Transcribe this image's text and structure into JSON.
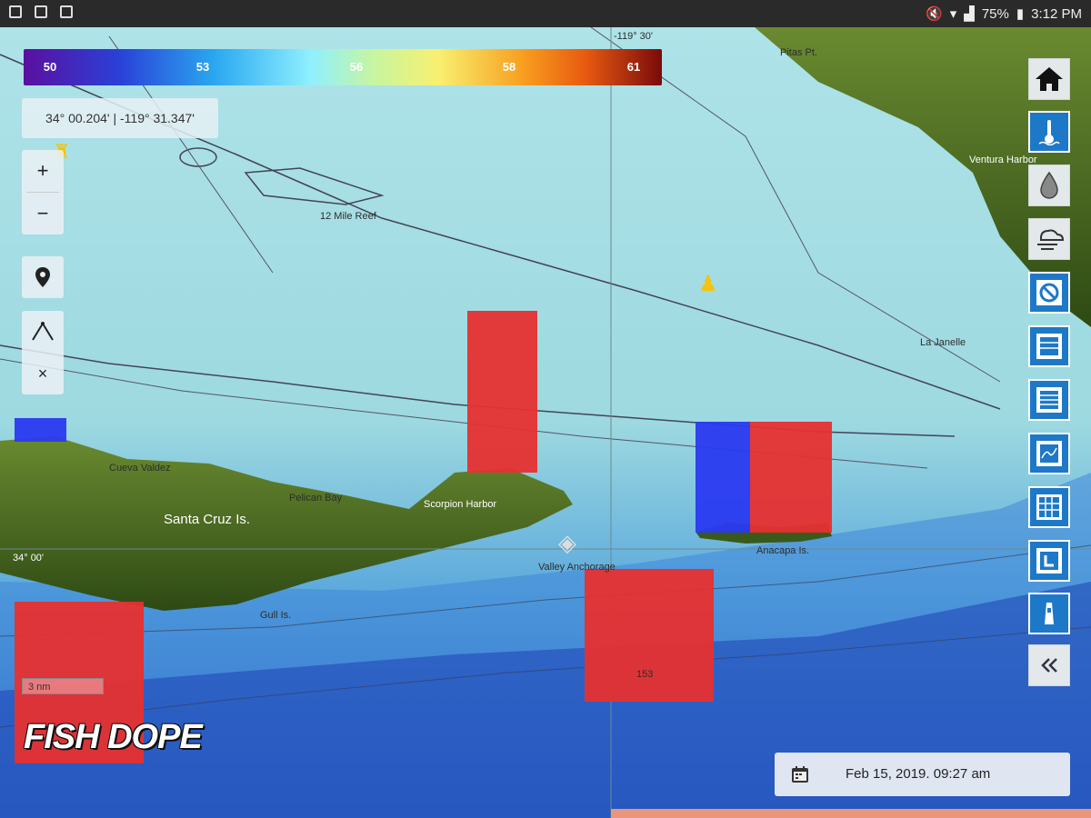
{
  "status": {
    "battery": "75%",
    "time": "3:12 PM"
  },
  "legend": {
    "ticks": [
      "50",
      "53",
      "56",
      "58",
      "61"
    ]
  },
  "coords": "34° 00.204' | -119° 31.347'",
  "map_controls": {
    "zoom_in": "+",
    "zoom_out": "−",
    "close": "×"
  },
  "map_labels": {
    "top_longitude": "-119° 30'",
    "pitas_pt": "Pitas Pt.",
    "ventura_harbor": "Ventura Harbor",
    "reef": "12 Mile Reef",
    "la_janelle": "La Janelle",
    "cueva_valdez": "Cueva Valdez",
    "pelican_bay": "Pelican Bay",
    "santa_cruz": "Santa Cruz Is.",
    "scorpion": "Scorpion Harbor",
    "anacapa": "Anacapa Is.",
    "latitude": "34° 00'",
    "gull_island": "Gull Is.",
    "valley_anchorage": "Valley Anchorage",
    "depth": "153"
  },
  "scale": "3 nm",
  "logo": "FISH DOPE",
  "date": "Feb 15, 2019. 09:27 am",
  "sidebar_icons": [
    "home-icon",
    "temperature-icon",
    "water-drop-icon",
    "wind-icon",
    "no-entry-icon",
    "layers-icon",
    "layers-grid-icon",
    "chart-map-icon",
    "grid-icon",
    "l-layer-icon",
    "lighthouse-icon",
    "collapse-icon"
  ],
  "colors": {
    "highlight_red": "#e63030",
    "highlight_blue": "#2a3af0",
    "sidebar_blue": "#1e78c8"
  }
}
